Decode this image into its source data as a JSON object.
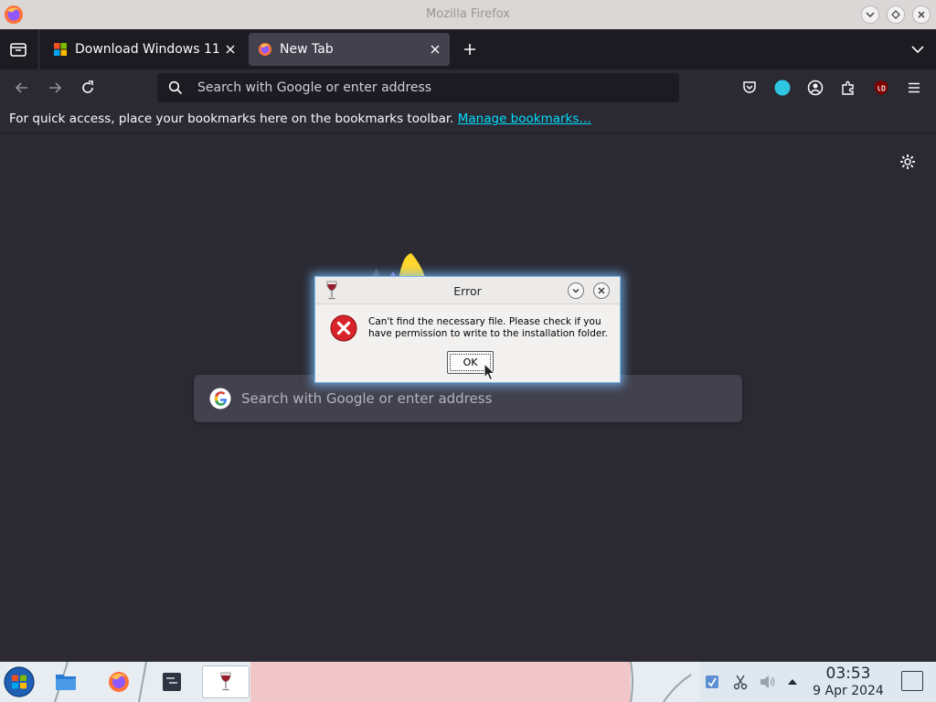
{
  "window": {
    "title": "Mozilla Firefox",
    "app_icon": "firefox-icon",
    "controls": [
      "minimize-icon",
      "maximize-icon",
      "close-icon"
    ]
  },
  "tabs": [
    {
      "label": "Download Windows 11",
      "icon": "windows-logo-icon",
      "active": false
    },
    {
      "label": "New Tab",
      "icon": "firefox-icon",
      "active": true
    }
  ],
  "navbar": {
    "url_placeholder": "Search with Google or enter address",
    "icons": [
      "back-icon",
      "forward-icon",
      "reload-icon",
      "pocket-icon",
      "firefox-view-icon",
      "account-icon",
      "extensions-icon",
      "ublock-icon",
      "menu-icon"
    ]
  },
  "bookmarks": {
    "message": "For quick access, place your bookmarks here on the bookmarks toolbar.",
    "link": "Manage bookmarks…"
  },
  "newtab": {
    "search_placeholder": "Search with Google or enter address",
    "settings_icon": "gear-icon"
  },
  "dialog": {
    "title": "Error",
    "message": "Can't find the necessary file. Please check if you have permission to write to the installation folder.",
    "ok_label": "OK",
    "icon": "error-icon"
  },
  "taskbar": {
    "apps": [
      "start-icon",
      "file-manager-icon",
      "firefox-icon",
      "terminal-icon",
      "wine-icon"
    ],
    "tray_icons": [
      "updates-icon",
      "clipboard-icon",
      "volume-icon",
      "tray-expand-icon"
    ],
    "time": "03:53",
    "date": "9 Apr 2024"
  },
  "colors": {
    "link": "#00ddff",
    "dialog_glow": "#78beff",
    "error_red": "#d8232a",
    "taskbar_pink": "#f1c6c8"
  }
}
